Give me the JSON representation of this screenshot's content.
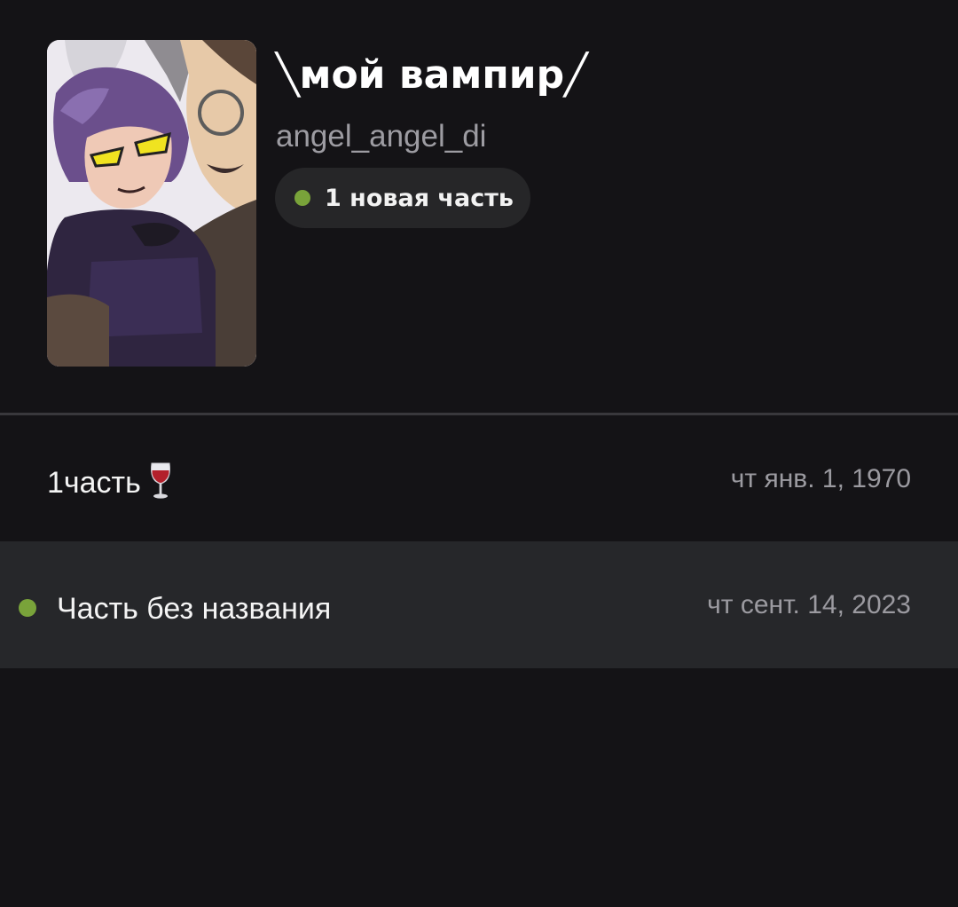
{
  "story": {
    "title": "╲мой вампир╱",
    "author": "angel_angel_di",
    "new_parts_label": "1 новая часть",
    "cover_icon": "story-cover-image"
  },
  "parts": [
    {
      "title": "1часть",
      "title_icon": "wine-glass-icon",
      "date": "чт янв. 1, 1970",
      "is_new": false
    },
    {
      "title": "Часть без названия",
      "date": "чт сент. 14, 2023",
      "is_new": true
    }
  ],
  "colors": {
    "background": "#141316",
    "new_indicator": "#79a33a",
    "highlight_row": "#26272a",
    "badge": "#262628"
  }
}
